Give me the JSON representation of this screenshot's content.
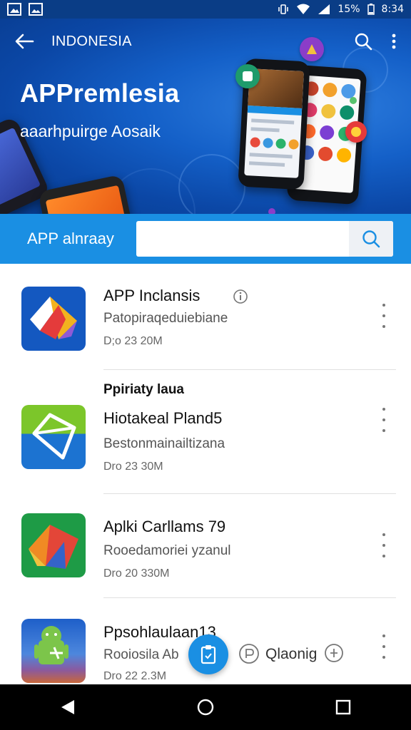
{
  "status_bar": {
    "battery": "15%",
    "time": "8:34"
  },
  "toolbar": {
    "title": "INDONESIA"
  },
  "hero": {
    "title": "APPremlesia",
    "subtitle": "aaarhpuirge Aosaik"
  },
  "search": {
    "label": "APP alnraay",
    "value": "",
    "placeholder": ""
  },
  "apps": [
    {
      "name": "APP Inclansis",
      "description": "Patopiraqeduiebiane",
      "meta": "D;o 23 20M"
    },
    {
      "name": "Hiotakeal Pland5",
      "description": "Bestonmainailtizana",
      "meta": "Dro 23 30M"
    },
    {
      "name": "Aplki Carllams 79",
      "description": "Rooedamoriei yzanul",
      "meta": "Dro 20 330M"
    },
    {
      "name": "Ppsohlaulaan13",
      "description": "Rooiosila Ab",
      "meta": "Dro 22 2.3M"
    }
  ],
  "section": {
    "header": "Ppiriaty laua"
  },
  "overlay": {
    "text": "Qlaonig"
  },
  "colors": {
    "primary": "#1a8fe3",
    "hero_dark": "#0b47a6",
    "fab": "#1a8fe3"
  },
  "icons": [
    "back-arrow-icon",
    "search-icon",
    "more-vert-icon",
    "info-icon",
    "clipboard-icon",
    "back-nav-icon",
    "home-nav-icon",
    "recents-nav-icon"
  ]
}
